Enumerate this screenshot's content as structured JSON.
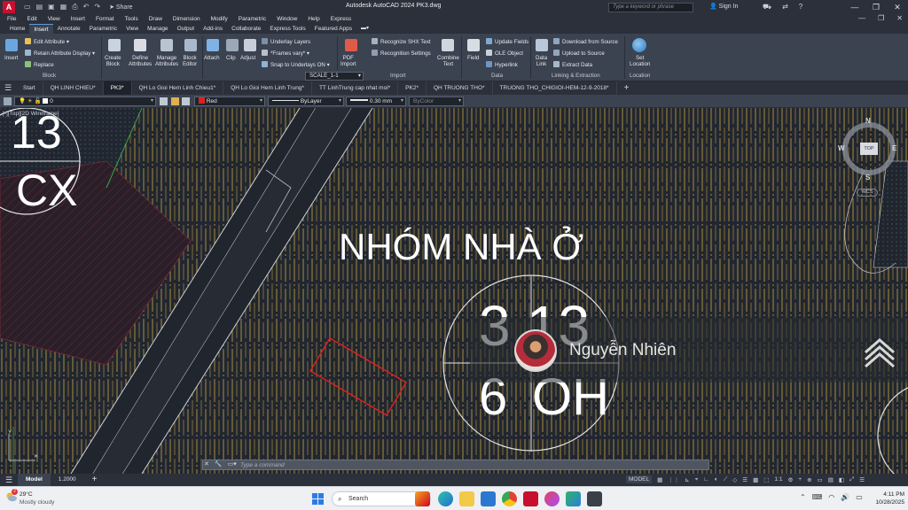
{
  "titlebar": {
    "app_logo": "A",
    "share": "Share",
    "title": "Autodesk AutoCAD 2024    PK3.dwg",
    "search_placeholder": "Type a keyword or phrase",
    "signin": "Sign In"
  },
  "menu": [
    "File",
    "Edit",
    "View",
    "Insert",
    "Format",
    "Tools",
    "Draw",
    "Dimension",
    "Modify",
    "Parametric",
    "Window",
    "Help",
    "Express"
  ],
  "ribbon_tabs": [
    "Home",
    "Insert",
    "Annotate",
    "Parametric",
    "View",
    "Manage",
    "Output",
    "Add-ins",
    "Collaborate",
    "Express Tools",
    "Featured Apps"
  ],
  "ribbon_active_tab": "Insert",
  "ribbon": {
    "insert": "Insert",
    "edit_attribute": "Edit Attribute",
    "retain_attribute_display": "Retain Attribute Display",
    "replace": "Replace",
    "block_group": "Block",
    "create_block": "Create\nBlock",
    "define_attributes": "Define\nAttributes",
    "manage_attributes": "Manage\nAttributes",
    "block_editor": "Block\nEditor",
    "attach": "Attach",
    "clip": "Clip",
    "adjust": "Adjust",
    "underlay_layers": "Underlay Layers",
    "frames_vary": "*Frames vary*",
    "snap_to_underlays": "Snap to Underlays ON",
    "scale": "SCALE_1-1",
    "pdf_import": "PDF\nImport",
    "recognize_shx": "Recognize SHX Text",
    "recognition_settings": "Recognition Settings",
    "combine_text": "Combine\nText",
    "import_group": "Import",
    "field": "Field",
    "update_fields": "Update Fields",
    "ole_object": "OLE Object",
    "hyperlink": "Hyperlink",
    "data_group": "Data",
    "data_link": "Data\nLink",
    "download_from_source": "Download from Source",
    "upload_to_source": "Upload to Source",
    "extract_data": "Extract  Data",
    "linking_group": "Linking & Extraction",
    "set_location": "Set\nLocation",
    "location_group": "Location"
  },
  "file_tabs": [
    "Start",
    "QH LINH CHIEU*",
    "PK3*",
    "QH Lo Gioi Hem Linh Chieu1*",
    "QH Lo Gioi Hem Linh Trung*",
    "TT LinhTrung cap nhat moi*",
    "PK2*",
    "QH TRUONG THO*",
    "TRUONG THO_CHIGIOI-HEM-12-9-2018*"
  ],
  "file_tab_active": "PK3*",
  "properties": {
    "layer": "0",
    "color": "Red",
    "linetype": "ByLayer",
    "lineweight": "0.30 mm",
    "plotstyle": "ByColor"
  },
  "viewport_label": "[-][Top][2D Wireframe]",
  "drawing": {
    "text_13": "13",
    "text_cx": "CX",
    "group_title": "NHÓM NHÀ Ở",
    "lot_tl": "3",
    "lot_tr": "13",
    "lot_bl": "6",
    "lot_br": "OH"
  },
  "navcube": {
    "n": "N",
    "s": "S",
    "e": "E",
    "w": "W",
    "top": "TOP",
    "wcs": "WCS"
  },
  "overlay": {
    "name": "Nguyễn Nhiên"
  },
  "command_placeholder": "Type a command",
  "layout_tabs": [
    "Model",
    "1.2000"
  ],
  "layout_active": "Model",
  "status": {
    "model": "MODEL",
    "scale": "1:1"
  },
  "taskbar": {
    "temp": "29°C",
    "weather": "Mostly cloudy",
    "search": "Search",
    "time": "4:11 PM",
    "date": "10/28/2025"
  },
  "colors": {
    "accent": "#5b9bd5",
    "layer_red": "#e02020",
    "autocad_red": "#c8102e"
  }
}
